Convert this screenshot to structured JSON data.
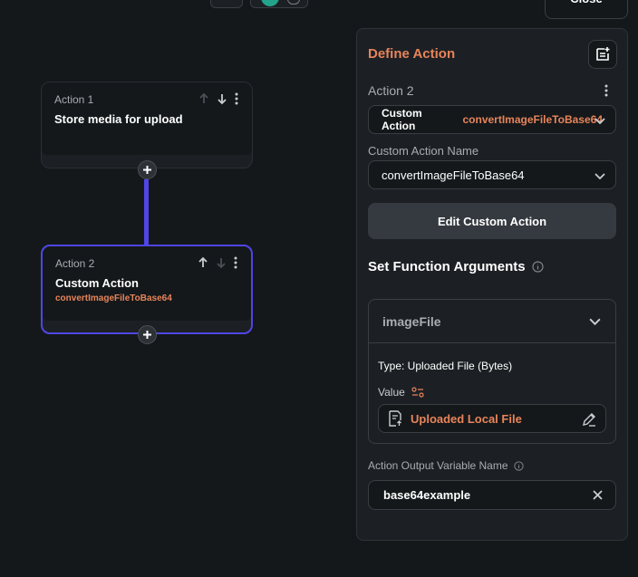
{
  "toolbar": {
    "close_label": "Close"
  },
  "canvas": {
    "action1": {
      "label": "Action 1",
      "title": "Store media for upload"
    },
    "action2": {
      "label": "Action 2",
      "title": "Custom Action",
      "subtitle": "convertImageFileToBase64"
    }
  },
  "panel": {
    "title": "Define Action",
    "action_label": "Action 2",
    "action_type": {
      "prefix": "Custom Action",
      "name": "convertImageFileToBase64"
    },
    "custom_action_name_label": "Custom Action Name",
    "custom_action_name_value": "convertImageFileToBase64",
    "edit_button_label": "Edit Custom Action",
    "set_args_title": "Set Function Arguments",
    "argument": {
      "name": "imageFile",
      "type_text": "Type: Uploaded File (Bytes)",
      "value_label": "Value",
      "value_text": "Uploaded Local File"
    },
    "output_label": "Action Output Variable Name",
    "output_value": "base64example"
  },
  "colors": {
    "accent_orange": "#e8845a",
    "accent_purple": "#4f46e5",
    "background": "#14181b",
    "panel": "#1c2024"
  }
}
